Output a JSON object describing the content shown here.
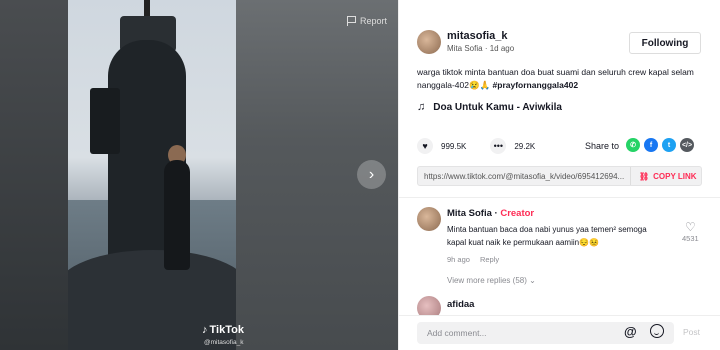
{
  "video": {
    "report_label": "Report",
    "next_icon": "chevron-right-icon",
    "watermark_brand": "TikTok",
    "watermark_user": "@mitasofia_k"
  },
  "author": {
    "username": "mitasofia_k",
    "display_name": "Mita Sofia",
    "time_ago": "1d ago",
    "follow_label": "Following"
  },
  "post": {
    "caption": "warga tiktok minta bantuan doa buat suami dan seluruh crew kapal selam nanggala-402😢🙏",
    "hashtag": "#prayfornanggala402",
    "music": "Doa Untuk Kamu - Aviwkila",
    "likes": "999.5K",
    "comments_count": "29.2K",
    "share_label": "Share to",
    "share_targets": [
      "whatsapp",
      "facebook",
      "twitter",
      "embed"
    ],
    "link": "https://www.tiktok.com/@mitasofia_k/video/695412694...",
    "copy_link_label": "COPY LINK"
  },
  "comments": [
    {
      "name": "Mita Sofia",
      "badge": "Creator",
      "text": "Minta bantuan baca doa nabi yunus yaa temen² semoga kapal kuat naik ke permukaan aamiin😔😣",
      "time": "9h ago",
      "reply_label": "Reply",
      "likes": "4531",
      "view_more": "View more replies (58)"
    },
    {
      "name": "afidaa"
    }
  ],
  "comment_box": {
    "placeholder": "Add comment...",
    "post_label": "Post"
  },
  "colors": {
    "accent": "#fe2c55",
    "whatsapp": "#25d366",
    "facebook": "#1877f2",
    "twitter": "#1da1f2",
    "embed": "#54595e"
  }
}
